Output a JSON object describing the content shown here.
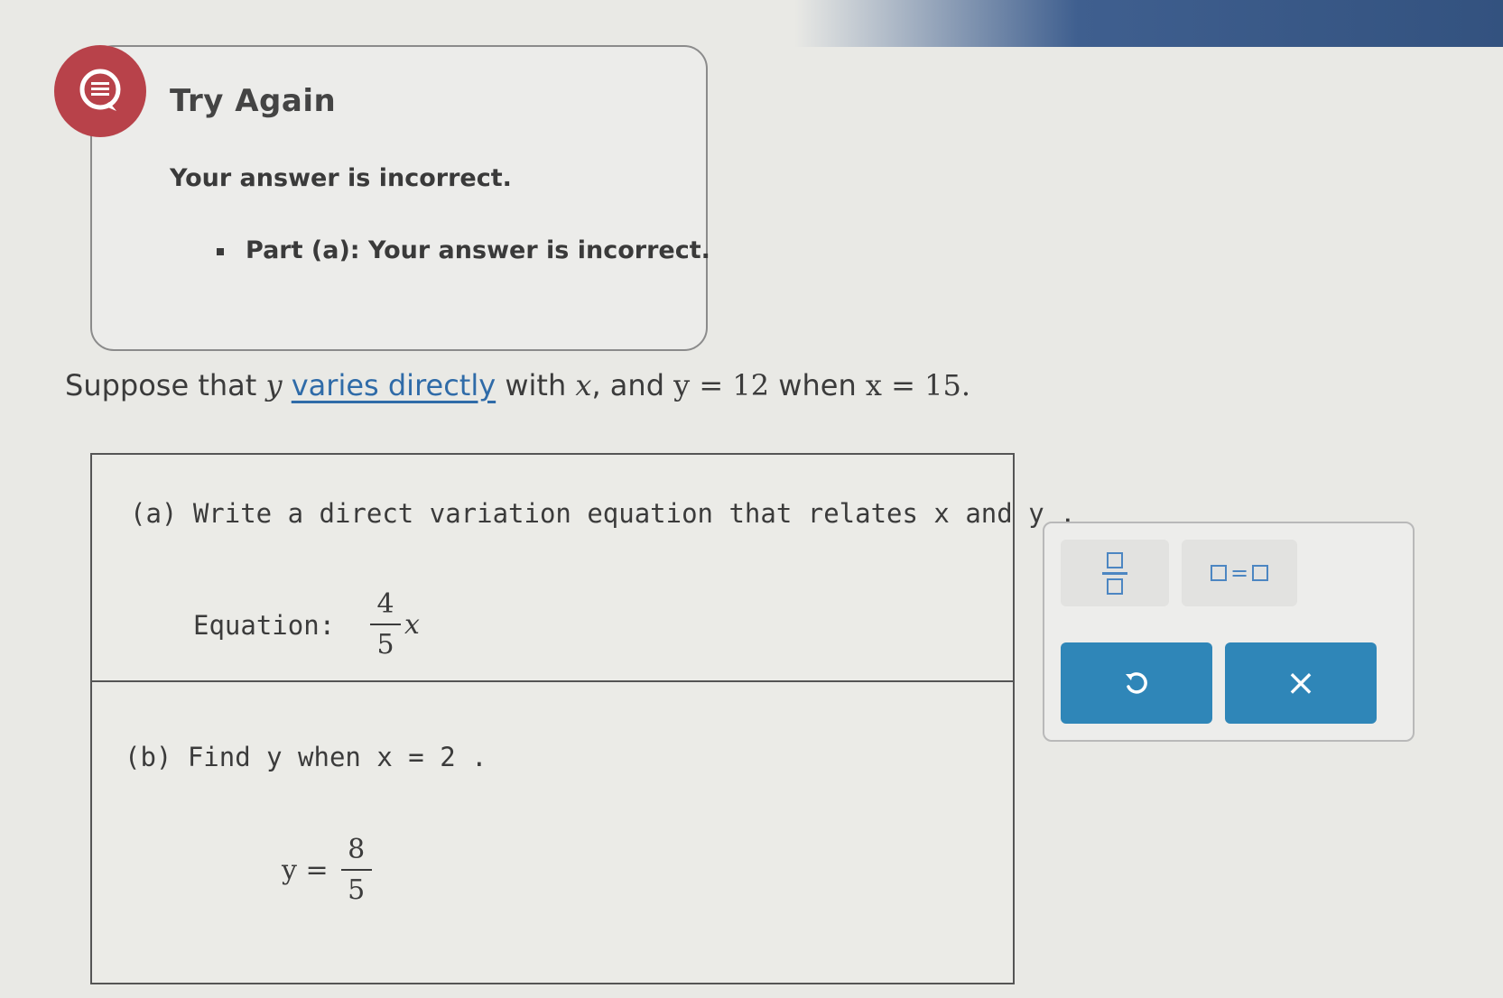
{
  "feedback": {
    "title": "Try Again",
    "message": "Your answer is incorrect.",
    "items": [
      "Part (a): Your answer is incorrect."
    ],
    "icon": "message-alert-icon",
    "icon_color": "#b8424a"
  },
  "problem": {
    "intro": "Suppose that ",
    "y_var": "y",
    "link_text": "varies directly",
    "with_text": " with ",
    "x_var": "x",
    "and_text": ", and ",
    "given_y": "y = 12",
    "when_text": " when ",
    "given_x": "x = 15."
  },
  "part_a": {
    "prompt": "(a) Write a direct variation equation that relates x and y .",
    "label": "Equation:",
    "answer_numerator": "4",
    "answer_denominator": "5",
    "answer_variable": "x"
  },
  "part_b": {
    "prompt": "(b) Find y  when x = 2 .",
    "lhs": "y =",
    "answer_numerator": "8",
    "answer_denominator": "5"
  },
  "keypad": {
    "fraction_key": "fraction-template-icon",
    "equation_key_symbol": "=",
    "undo_key": "undo-icon",
    "clear_key_symbol": "×",
    "accent_color": "#2f86b8"
  }
}
